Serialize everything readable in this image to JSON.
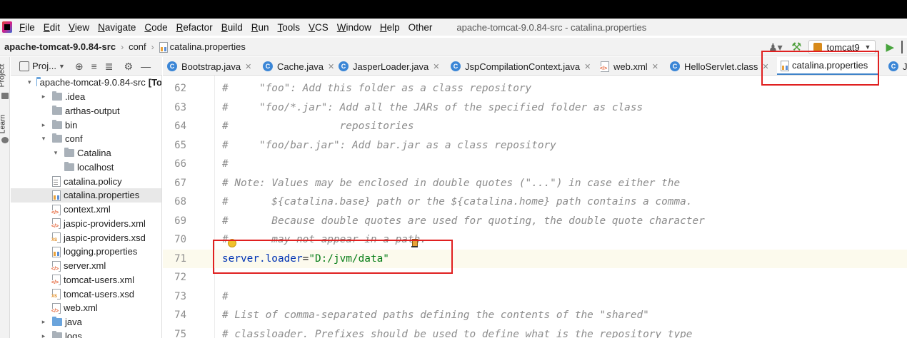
{
  "menu": {
    "items": [
      {
        "label": "File",
        "u": "F",
        "rest": "ile"
      },
      {
        "label": "Edit",
        "u": "E",
        "rest": "dit"
      },
      {
        "label": "View",
        "u": "V",
        "rest": "iew"
      },
      {
        "label": "Navigate",
        "u": "N",
        "rest": "avigate"
      },
      {
        "label": "Code",
        "u": "C",
        "rest": "ode"
      },
      {
        "label": "Refactor",
        "u": "R",
        "rest": "efactor"
      },
      {
        "label": "Build",
        "u": "B",
        "rest": "uild"
      },
      {
        "label": "Run",
        "u": "R",
        "rest": "un"
      },
      {
        "label": "Tools",
        "u": "T",
        "rest": "ools"
      },
      {
        "label": "VCS",
        "u": "V",
        "rest": "CS"
      },
      {
        "label": "Window",
        "u": "W",
        "rest": "indow"
      },
      {
        "label": "Help",
        "u": "H",
        "rest": "elp"
      },
      {
        "label": "Other",
        "u": "",
        "rest": "Other"
      }
    ],
    "window_title": "apache-tomcat-9.0.84-src - catalina.properties"
  },
  "breadcrumb": {
    "project": "apache-tomcat-9.0.84-src",
    "folder": "conf",
    "file": "catalina.properties"
  },
  "toolbar": {
    "run_config": "tomcat9"
  },
  "stripe": {
    "project_label": "Project",
    "learn_label": "Learn"
  },
  "project_panel": {
    "title": "Proj...",
    "tree": [
      {
        "label": "apache-tomcat-9.0.84-src",
        "suffix": "[To",
        "indent": 0,
        "arrow": "expanded",
        "icon": "folder-blue"
      },
      {
        "label": ".idea",
        "indent": 1,
        "arrow": "collapsed",
        "icon": "folder"
      },
      {
        "label": "arthas-output",
        "indent": 1,
        "arrow": "none",
        "icon": "folder"
      },
      {
        "label": "bin",
        "indent": 1,
        "arrow": "collapsed",
        "icon": "folder"
      },
      {
        "label": "conf",
        "indent": 1,
        "arrow": "expanded",
        "icon": "folder"
      },
      {
        "label": "Catalina",
        "indent": 2,
        "arrow": "expanded",
        "icon": "folder"
      },
      {
        "label": "localhost",
        "indent": 3,
        "arrow": "none",
        "icon": "folder"
      },
      {
        "label": "catalina.policy",
        "indent": 2,
        "arrow": "none",
        "icon": "file-policy"
      },
      {
        "label": "catalina.properties",
        "indent": 2,
        "arrow": "none",
        "icon": "file-properties",
        "selected": true
      },
      {
        "label": "context.xml",
        "indent": 2,
        "arrow": "none",
        "icon": "file-xml"
      },
      {
        "label": "jaspic-providers.xml",
        "indent": 2,
        "arrow": "none",
        "icon": "file-xml"
      },
      {
        "label": "jaspic-providers.xsd",
        "indent": 2,
        "arrow": "none",
        "icon": "file-xsd"
      },
      {
        "label": "logging.properties",
        "indent": 2,
        "arrow": "none",
        "icon": "file-properties"
      },
      {
        "label": "server.xml",
        "indent": 2,
        "arrow": "none",
        "icon": "file-xml"
      },
      {
        "label": "tomcat-users.xml",
        "indent": 2,
        "arrow": "none",
        "icon": "file-xml"
      },
      {
        "label": "tomcat-users.xsd",
        "indent": 2,
        "arrow": "none",
        "icon": "file-xsd"
      },
      {
        "label": "web.xml",
        "indent": 2,
        "arrow": "none",
        "icon": "file-xml"
      },
      {
        "label": "java",
        "indent": 1,
        "arrow": "collapsed",
        "icon": "folder-blue"
      },
      {
        "label": "logs",
        "indent": 1,
        "arrow": "collapsed",
        "icon": "folder"
      }
    ]
  },
  "tabs": [
    {
      "label": "Bootstrap.java",
      "icon": "class-icon",
      "active": false
    },
    {
      "label": "Cache.java",
      "icon": "class-icon",
      "active": false
    },
    {
      "label": "JasperLoader.java",
      "icon": "class-icon",
      "active": false
    },
    {
      "label": "JspCompilationContext.java",
      "icon": "class-icon",
      "active": false
    },
    {
      "label": "web.xml",
      "icon": "xml-file-icon",
      "active": false
    },
    {
      "label": "HelloServlet.class",
      "icon": "class-icon",
      "active": false
    },
    {
      "label": "catalina.properties",
      "icon": "properties-file-icon",
      "active": true
    },
    {
      "label": "J",
      "icon": "class-icon",
      "active": false
    }
  ],
  "editor": {
    "lines": [
      {
        "num": "62",
        "text": "#     \"foo\": Add this folder as a class repository",
        "type": "comment"
      },
      {
        "num": "63",
        "text": "#     \"foo/*.jar\": Add all the JARs of the specified folder as class",
        "type": "comment"
      },
      {
        "num": "64",
        "text": "#                  repositories",
        "type": "comment"
      },
      {
        "num": "65",
        "text": "#     \"foo/bar.jar\": Add bar.jar as a class repository",
        "type": "comment"
      },
      {
        "num": "66",
        "text": "#",
        "type": "comment"
      },
      {
        "num": "67",
        "text": "# Note: Values may be enclosed in double quotes (\"...\") in case either the",
        "type": "comment"
      },
      {
        "num": "68",
        "text": "#       ${catalina.base} path or the ${catalina.home} path contains a comma.",
        "type": "comment"
      },
      {
        "num": "69",
        "text": "#       Because double quotes are used for quoting, the double quote character",
        "type": "comment"
      },
      {
        "num": "70",
        "text": "#       may not appear in a path.",
        "type": "comment"
      },
      {
        "num": "71",
        "key": "server.loader",
        "eq": "=",
        "value": "\"D:/jvm/data\"",
        "type": "property",
        "current": true
      },
      {
        "num": "72",
        "text": "",
        "type": "comment"
      },
      {
        "num": "73",
        "text": "#",
        "type": "comment"
      },
      {
        "num": "74",
        "text": "# List of comma-separated paths defining the contents of the \"shared\"",
        "type": "comment"
      },
      {
        "num": "75",
        "text": "# classloader. Prefixes should be used to define what is the repository type",
        "type": "comment"
      }
    ]
  },
  "colors": {
    "highlight_box": "#e02020",
    "property_key": "#0033b3",
    "property_value": "#067d17",
    "comment": "#8c8c8c",
    "active_tab_underline": "#4083c9"
  }
}
